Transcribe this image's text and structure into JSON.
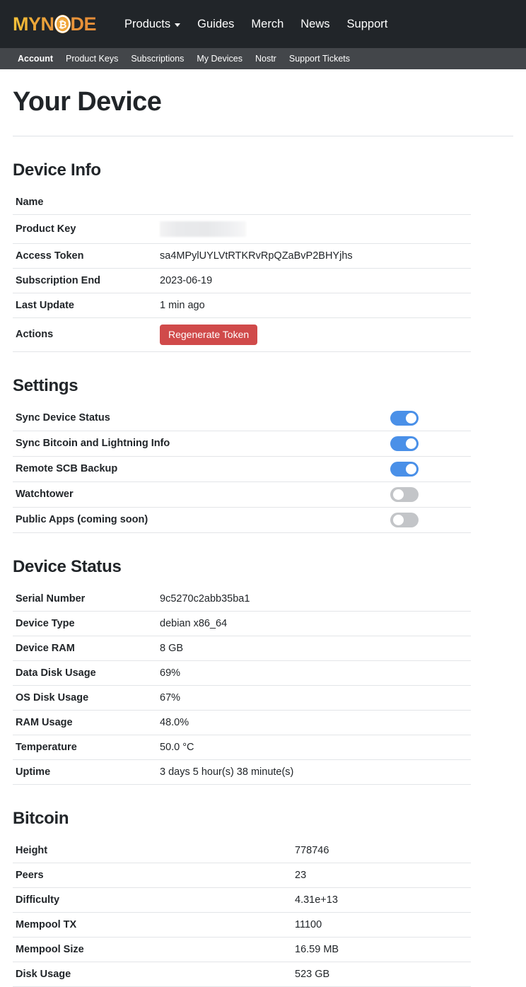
{
  "header": {
    "logo_text": "MYNODE",
    "logo_part1": "MY",
    "logo_part2": "N",
    "logo_part3": "DE",
    "logo_bitcoin_symbol": "₿",
    "nav": [
      {
        "label": "Products",
        "has_dropdown": true
      },
      {
        "label": "Guides",
        "has_dropdown": false
      },
      {
        "label": "Merch",
        "has_dropdown": false
      },
      {
        "label": "News",
        "has_dropdown": false
      },
      {
        "label": "Support",
        "has_dropdown": false
      }
    ],
    "subnav": [
      {
        "label": "Account",
        "active": true
      },
      {
        "label": "Product Keys",
        "active": false
      },
      {
        "label": "Subscriptions",
        "active": false
      },
      {
        "label": "My Devices",
        "active": false
      },
      {
        "label": "Nostr",
        "active": false
      },
      {
        "label": "Support Tickets",
        "active": false
      }
    ]
  },
  "page": {
    "title": "Your Device"
  },
  "device_info": {
    "title": "Device Info",
    "rows": [
      {
        "label": "Name",
        "value": ""
      },
      {
        "label": "Product Key",
        "value": "",
        "redacted": true
      },
      {
        "label": "Access Token",
        "value": "sa4MPylUYLVtRTKRvRpQZaBvP2BHYjhs"
      },
      {
        "label": "Subscription End",
        "value": "2023-06-19"
      },
      {
        "label": "Last Update",
        "value": "1 min ago"
      },
      {
        "label": "Actions",
        "value": ""
      }
    ],
    "regenerate_button": "Regenerate Token"
  },
  "settings": {
    "title": "Settings",
    "rows": [
      {
        "label": "Sync Device Status",
        "enabled": true
      },
      {
        "label": "Sync Bitcoin and Lightning Info",
        "enabled": true
      },
      {
        "label": "Remote SCB Backup",
        "enabled": true
      },
      {
        "label": "Watchtower",
        "enabled": false
      },
      {
        "label": "Public Apps (coming soon)",
        "enabled": false
      }
    ]
  },
  "device_status": {
    "title": "Device Status",
    "rows": [
      {
        "label": "Serial Number",
        "value": "9c5270c2abb35ba1"
      },
      {
        "label": "Device Type",
        "value": "debian x86_64"
      },
      {
        "label": "Device RAM",
        "value": "8 GB"
      },
      {
        "label": "Data Disk Usage",
        "value": "69%"
      },
      {
        "label": "OS Disk Usage",
        "value": "67%"
      },
      {
        "label": "RAM Usage",
        "value": "48.0%"
      },
      {
        "label": "Temperature",
        "value": "50.0 °C"
      },
      {
        "label": "Uptime",
        "value": "3 days 5 hour(s) 38 minute(s)"
      }
    ]
  },
  "bitcoin": {
    "title": "Bitcoin",
    "rows": [
      {
        "label": "Height",
        "value": "778746"
      },
      {
        "label": "Peers",
        "value": "23"
      },
      {
        "label": "Difficulty",
        "value": "4.31e+13"
      },
      {
        "label": "Mempool TX",
        "value": "11100"
      },
      {
        "label": "Mempool Size",
        "value": "16.59 MB"
      },
      {
        "label": "Disk Usage",
        "value": "523 GB"
      }
    ]
  },
  "colors": {
    "header_bg": "#212529",
    "subnav_bg": "#43464a",
    "logo_orange": "#e9953a",
    "logo_yellow": "#f5c33b",
    "toggle_on": "#4a90e8",
    "toggle_off": "#c3c5c8",
    "danger": "#d04a4a"
  }
}
